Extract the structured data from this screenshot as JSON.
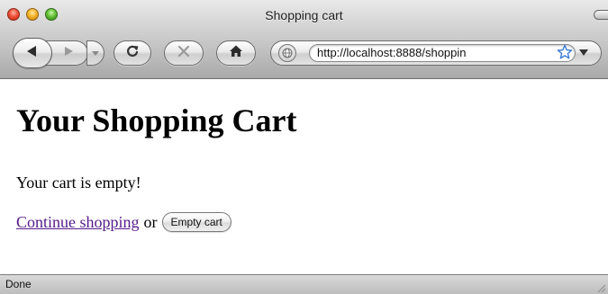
{
  "window": {
    "title": "Shopping cart"
  },
  "toolbar": {
    "back_icon": "back-arrow-icon",
    "forward_icon": "forward-arrow-icon",
    "reload_icon": "reload-icon",
    "stop_icon": "stop-icon",
    "home_icon": "home-icon"
  },
  "address_bar": {
    "url": "http://localhost:8888/shoppin",
    "site_icon": "globe-icon",
    "bookmark_icon": "star-icon"
  },
  "page": {
    "heading": "Your Shopping Cart",
    "cart_status": "Your cart is empty!",
    "continue_link": "Continue shopping",
    "or_text": "or",
    "empty_cart_button": "Empty cart"
  },
  "statusbar": {
    "text": "Done"
  },
  "colors": {
    "visited_link": "#551a8b",
    "close_button": "#f0523a",
    "minimize_button": "#f5b52a",
    "zoom_button": "#66c23a",
    "bookmark_star": "#3a7bd5"
  }
}
